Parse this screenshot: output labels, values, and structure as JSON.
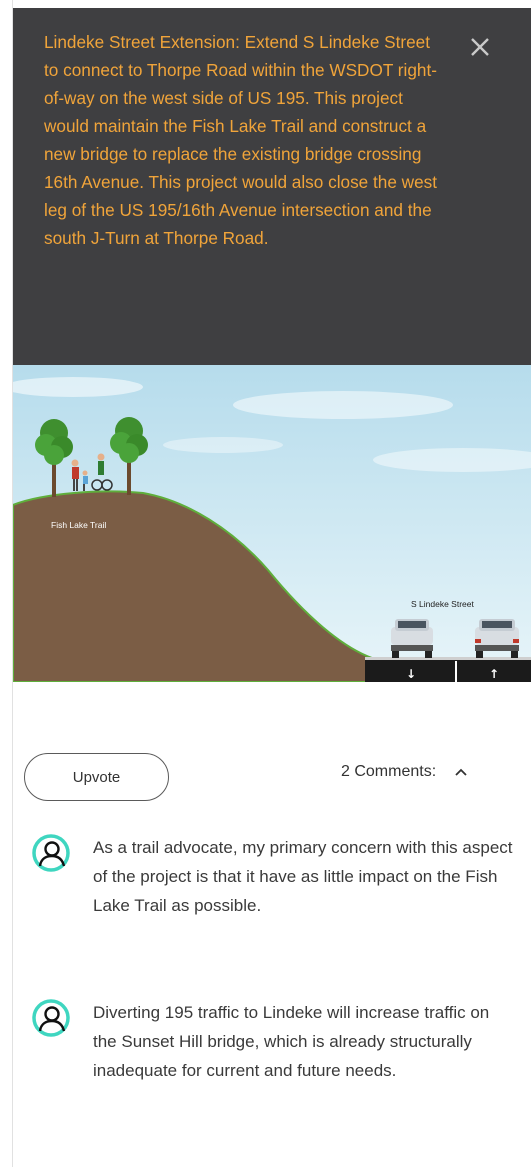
{
  "popup": {
    "description": "Lindeke Street Extension: Extend S Lindeke Street to connect to Thorpe Road within the WSDOT right-of-way on the west side of US 195. This project would maintain the Fish Lake Trail and construct a new bridge to replace the existing bridge crossing 16th Avenue. This project would also close the west leg of the US 195/16th Avenue intersection and the south J-Turn at Thorpe Road.",
    "close_icon": "close-icon"
  },
  "illustration": {
    "trail_label": "Fish Lake Trail",
    "street_label": "S Lindeke Street",
    "arrow_down": "↓",
    "arrow_up": "↑"
  },
  "actions": {
    "upvote_label": "Upvote",
    "comments_label": "2 Comments:",
    "toggle_icon": "chevron-up-icon"
  },
  "comments": [
    {
      "text": "As a trail advocate, my primary concern with this aspect of the project is that it have as little impact on the Fish Lake Trail as possible."
    },
    {
      "text": "Diverting 195 traffic to Lindeke will increase traffic on the Sunset Hill bridge, which is already structurally inadequate for current and future needs."
    }
  ],
  "colors": {
    "header_bg": "#3f3f41",
    "header_text": "#f0a43a",
    "avatar_ring": "#3fd6c0",
    "sky": "#bfe3f0",
    "hill": "#7b5d45",
    "road": "#1b1b1b"
  }
}
